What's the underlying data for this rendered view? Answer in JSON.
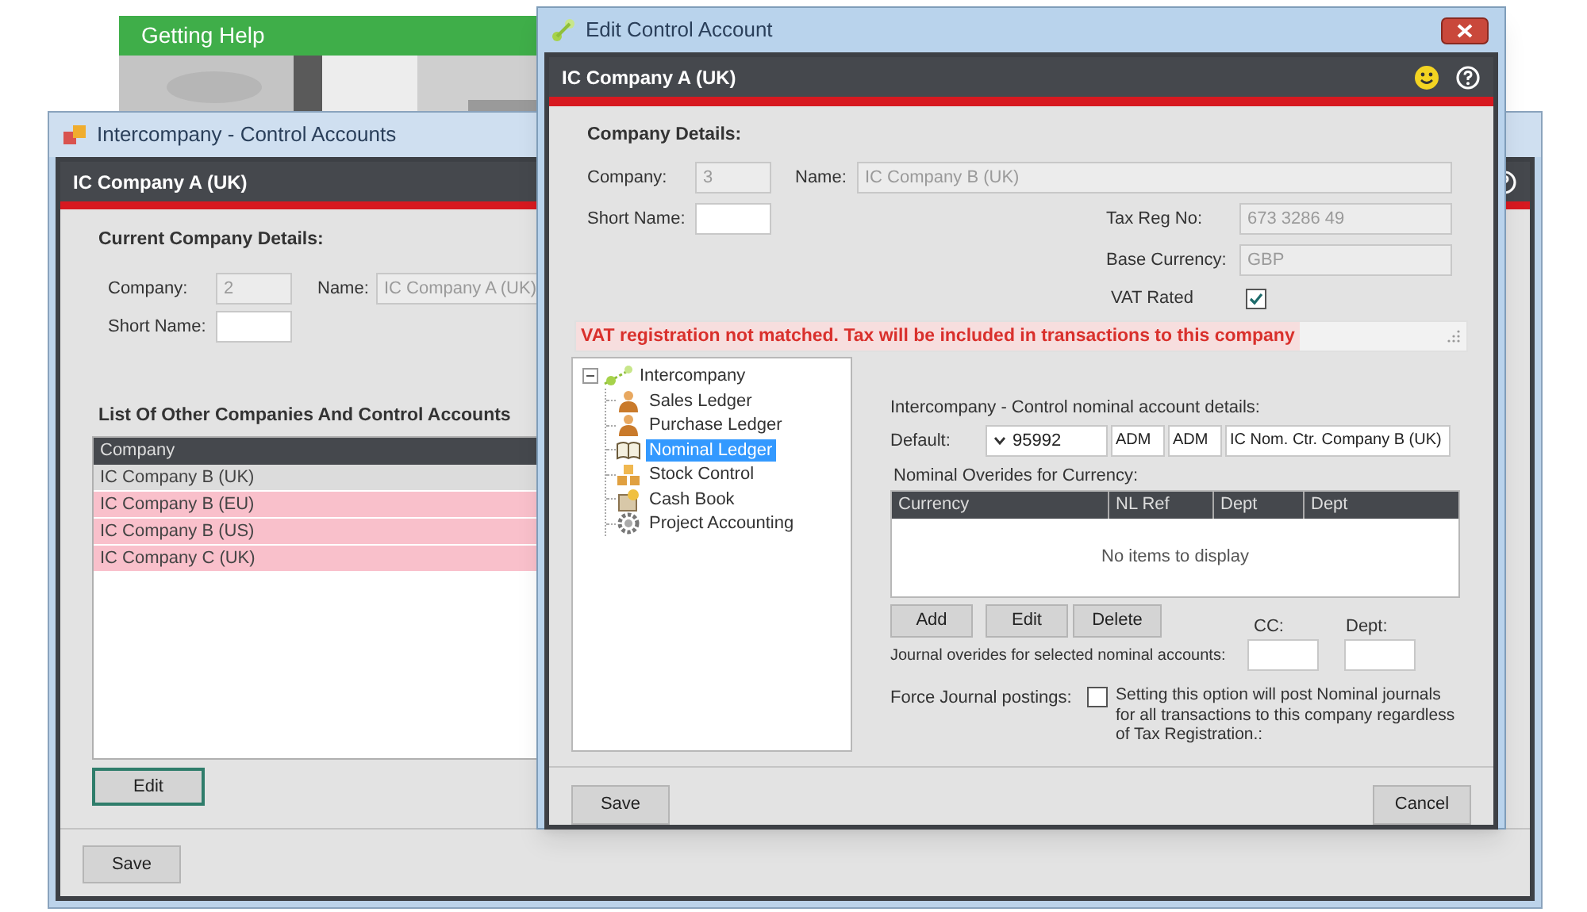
{
  "help_panel": {
    "title": "Getting Help"
  },
  "back_window": {
    "title": "Intercompany - Control Accounts",
    "header": "IC Company A (UK)",
    "details_title": "Current Company Details:",
    "company": {
      "label": "Company:",
      "value": "2",
      "disabled": true
    },
    "name": {
      "label": "Name:",
      "value": "IC Company A (UK)",
      "disabled": true
    },
    "short_name": {
      "label": "Short Name:",
      "disabled": false
    },
    "list_title": "List Of Other Companies And Control Accounts",
    "table": {
      "columns": [
        "Company"
      ],
      "rows": [
        {
          "company": "IC Company B (UK)",
          "highlighted": false
        },
        {
          "company": "IC Company B (EU)",
          "highlighted": true
        },
        {
          "company": "IC Company B (US)",
          "highlighted": true
        },
        {
          "company": "IC Company C (UK)",
          "highlighted": true
        }
      ]
    },
    "edit_button": {
      "label": "Edit",
      "focused": true
    },
    "save_button": {
      "label": "Save",
      "focused": false
    }
  },
  "edit_dialog": {
    "title": "Edit Control Account",
    "header": "IC Company A (UK)",
    "details_title": "Company Details:",
    "company": {
      "label": "Company:",
      "value": "3",
      "disabled": true
    },
    "name": {
      "label": "Name:",
      "value": "IC Company B (UK)",
      "disabled": true
    },
    "short_name": {
      "label": "Short Name:",
      "disabled": false
    },
    "tax_reg_no": {
      "label": "Tax Reg No:",
      "value": "673 3286 49",
      "disabled": true
    },
    "base_currency": {
      "label": "Base Currency:",
      "value": "GBP",
      "disabled": true
    },
    "vat_rated": {
      "label": "VAT Rated",
      "checked": true
    },
    "warning": "VAT registration not matched. Tax will be included in transactions to this company",
    "tree": {
      "label": "Intercompany",
      "expanded": true,
      "children": [
        {
          "label": "Sales Ledger",
          "kind": "person",
          "selected": false
        },
        {
          "label": "Purchase Ledger",
          "kind": "person",
          "selected": false
        },
        {
          "label": "Nominal Ledger",
          "kind": "book",
          "selected": true
        },
        {
          "label": "Stock Control",
          "kind": "stock",
          "selected": false
        },
        {
          "label": "Cash Book",
          "kind": "cash",
          "selected": false
        },
        {
          "label": "Project Accounting",
          "kind": "gear",
          "selected": false
        }
      ]
    },
    "control_title": "Intercompany - Control nominal account details:",
    "default": {
      "label": "Default:",
      "account": "95992",
      "cc": "ADM",
      "dept": "ADM",
      "description": "IC Nom. Ctr. Company B (UK)"
    },
    "overrides_title": "Nominal Overides for Currency:",
    "overrides_table": {
      "columns": [
        "Currency",
        "NL Ref",
        "Dept",
        "Dept"
      ],
      "empty_text": "No items to display"
    },
    "table_buttons": [
      "Add",
      "Edit",
      "Delete"
    ],
    "journal": {
      "label": "Journal overides for selected nominal accounts:",
      "cc_label": "CC:",
      "dept_label": "Dept:"
    },
    "force_journal": {
      "label": "Force Journal postings:",
      "checked": false,
      "note": "Setting this option will post Nominal journals for all transactions to this company regardless of Tax Registration.:"
    },
    "save_button": "Save",
    "cancel_button": "Cancel"
  }
}
